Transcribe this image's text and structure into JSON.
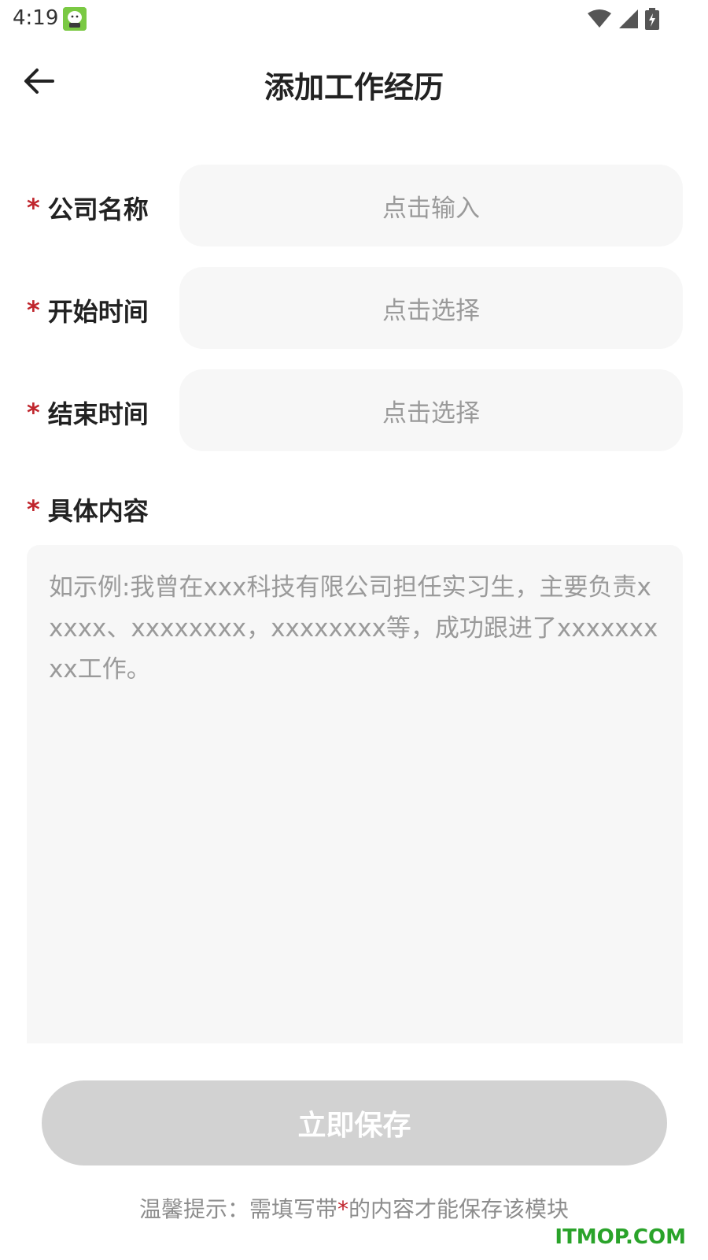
{
  "status_bar": {
    "time": "4:19",
    "icons": [
      "app-notification-icon",
      "wifi-icon",
      "signal-icon",
      "battery-charging-icon"
    ]
  },
  "header": {
    "title": "添加工作经历",
    "back_icon": "arrow-left-icon"
  },
  "form": {
    "required_mark": "*",
    "fields": [
      {
        "label": "公司名称",
        "placeholder": "点击输入"
      },
      {
        "label": "开始时间",
        "placeholder": "点击选择"
      },
      {
        "label": "结束时间",
        "placeholder": "点击选择"
      }
    ],
    "content": {
      "label": "具体内容",
      "placeholder": "如示例:我曾在xxx科技有限公司担任实习生，主要负责xxxxx、xxxxxxxx，xxxxxxxx等，成功跟进了xxxxxxxxx工作。"
    }
  },
  "save_button": {
    "label": "立即保存"
  },
  "tip": {
    "prefix": "温馨提示：需填写带",
    "star": "*",
    "suffix": "的内容才能保存该模块"
  },
  "watermark": "ITMOP.COM",
  "colors": {
    "required": "#c0262d",
    "field_bg": "#f7f7f7",
    "button_disabled": "#d2d2d2",
    "watermark": "#2aa32a"
  }
}
